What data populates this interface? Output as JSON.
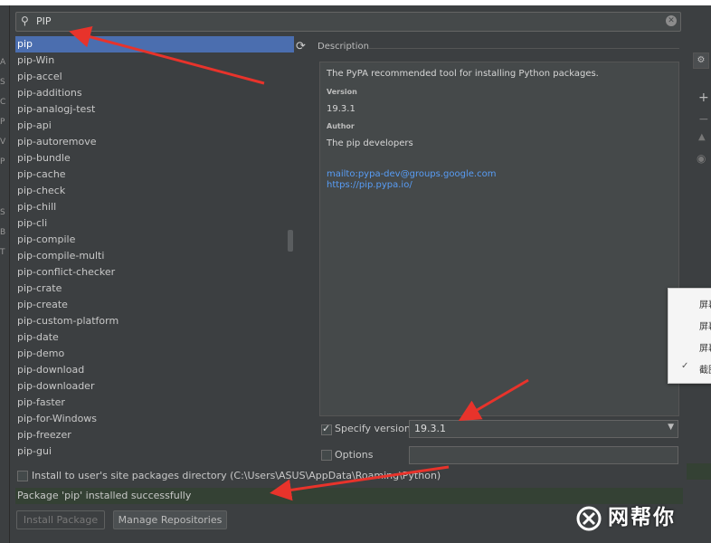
{
  "search": {
    "value": "PIP"
  },
  "packages": [
    "pip",
    "pip-Win",
    "pip-accel",
    "pip-additions",
    "pip-analogj-test",
    "pip-api",
    "pip-autoremove",
    "pip-bundle",
    "pip-cache",
    "pip-check",
    "pip-chill",
    "pip-cli",
    "pip-compile",
    "pip-compile-multi",
    "pip-conflict-checker",
    "pip-crate",
    "pip-create",
    "pip-custom-platform",
    "pip-date",
    "pip-demo",
    "pip-download",
    "pip-downloader",
    "pip-faster",
    "pip-for-Windows",
    "pip-freezer",
    "pip-gui"
  ],
  "selected_index": 0,
  "description": {
    "label": "Description",
    "summary": "The PyPA recommended tool for installing Python packages.",
    "version_heading": "Version",
    "version": "19.3.1",
    "author_heading": "Author",
    "author": "The pip developers",
    "mailto": "mailto:pypa-dev@groups.google.com",
    "homepage": "https://pip.pypa.io/"
  },
  "specify_version": {
    "label": "Specify version",
    "checked": true,
    "value": "19.3.1"
  },
  "options": {
    "label": "Options",
    "checked": false,
    "value": ""
  },
  "install_user": {
    "label": "Install to user's site packages directory (C:\\Users\\ASUS\\AppData\\Roaming\\Python)",
    "checked": false
  },
  "status": "Package 'pip' installed successfully",
  "buttons": {
    "install": "Install Package",
    "manage": "Manage Repositories"
  },
  "context_menu": [
    "屏幕",
    "屏幕",
    "屏幕",
    "截图"
  ],
  "watermark": "网帮你",
  "colors": {
    "selection": "#4b6eaf",
    "link": "#589df6",
    "success_bg": "#344134",
    "annotation_arrow": "#e8332b"
  }
}
